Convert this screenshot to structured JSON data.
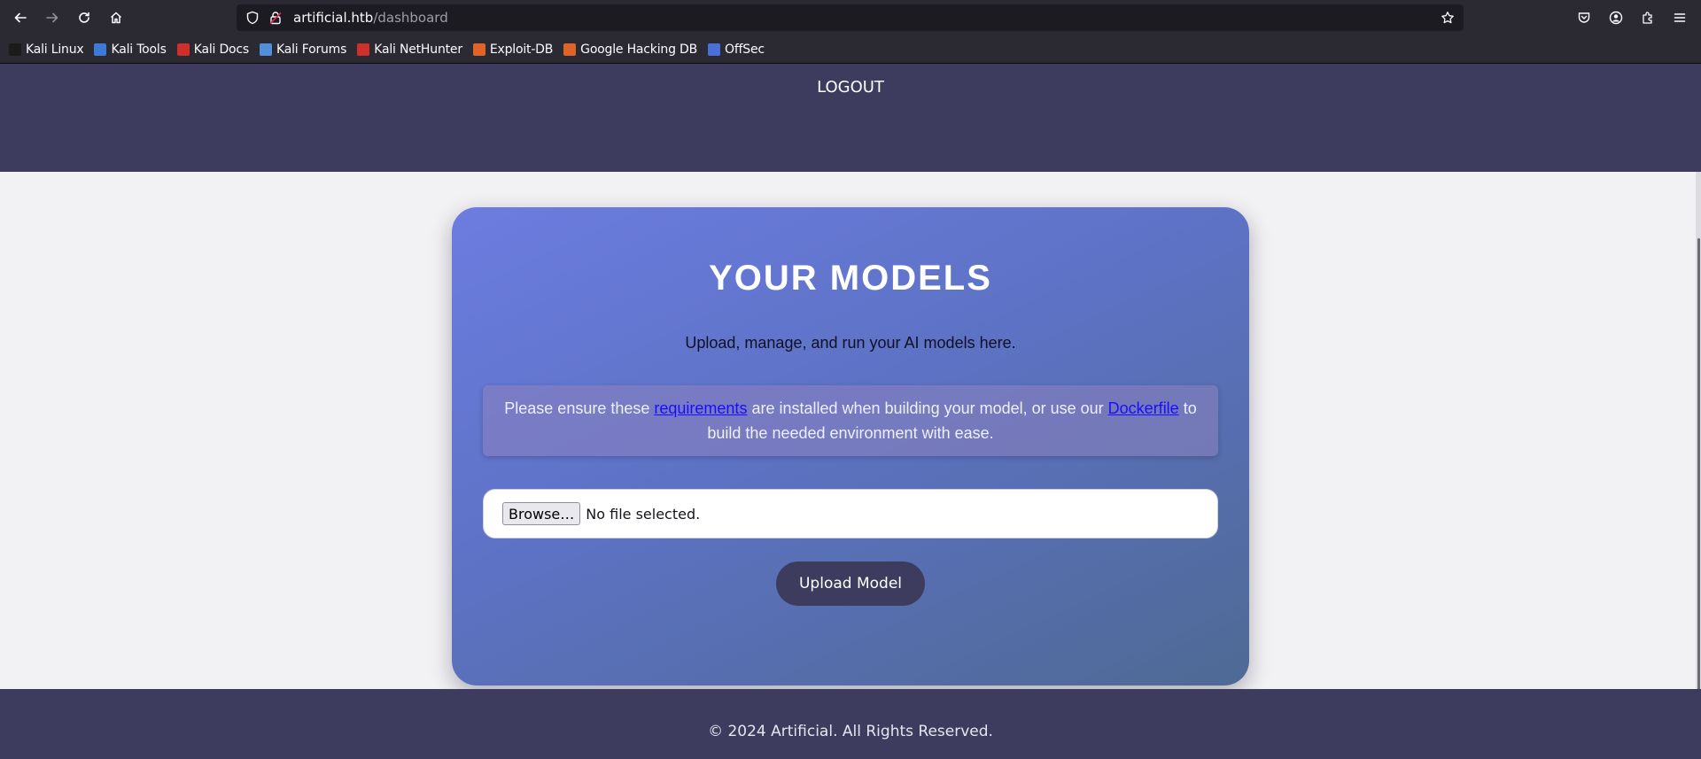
{
  "browser": {
    "url_host": "artificial.htb",
    "url_path": "/dashboard",
    "bookmarks": [
      {
        "label": "Kali Linux",
        "color": "#1b1b1b"
      },
      {
        "label": "Kali Tools",
        "color": "#3b7bd6"
      },
      {
        "label": "Kali Docs",
        "color": "#d0302c"
      },
      {
        "label": "Kali Forums",
        "color": "#4f8fdc"
      },
      {
        "label": "Kali NetHunter",
        "color": "#d0302c"
      },
      {
        "label": "Exploit-DB",
        "color": "#e0642a"
      },
      {
        "label": "Google Hacking DB",
        "color": "#e0642a"
      },
      {
        "label": "OffSec",
        "color": "#4a6fd8"
      }
    ]
  },
  "header": {
    "logout_label": "LOGOUT"
  },
  "card": {
    "title": "YOUR MODELS",
    "subtitle": "Upload, manage, and run your AI models here.",
    "notice_pre": "Please ensure these ",
    "notice_link1": "requirements",
    "notice_mid": " are installed when building your model, or use our ",
    "notice_link2": "Dockerfile",
    "notice_post": " to build the needed environment with ease.",
    "browse_label": "Browse…",
    "file_status": "No file selected.",
    "upload_label": "Upload Model"
  },
  "footer": {
    "copyright": "© 2024 Artificial. All Rights Reserved."
  },
  "colors": {
    "nav_bg": "#3d3b5e",
    "card_gradient_start": "#6c7ce0",
    "card_gradient_end": "#4e6a94"
  }
}
